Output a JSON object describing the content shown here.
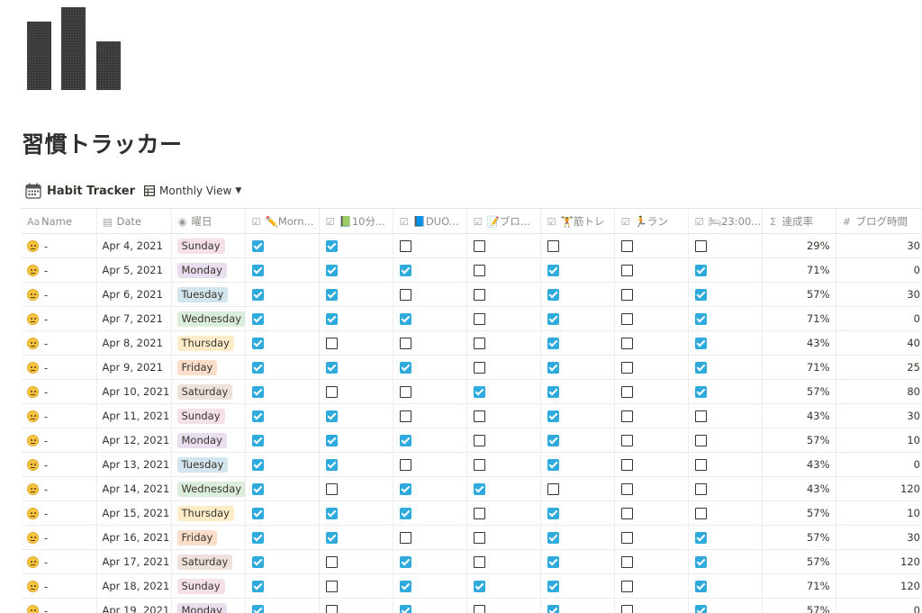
{
  "page": {
    "title": "習慣トラッカー"
  },
  "database": {
    "title": "Habit Tracker",
    "view_label": "Monthly View"
  },
  "columns": [
    {
      "key": "name",
      "label": "Name",
      "icon": "text-property-icon"
    },
    {
      "key": "date",
      "label": "Date",
      "icon": "calendar-property-icon"
    },
    {
      "key": "weekday",
      "label": "曜日",
      "icon": "select-property-icon"
    },
    {
      "key": "c1",
      "label": "✏️Morn...",
      "icon": "checkbox-property-icon"
    },
    {
      "key": "c2",
      "label": "📗10分...",
      "icon": "checkbox-property-icon"
    },
    {
      "key": "c3",
      "label": "📘DUO...",
      "icon": "checkbox-property-icon"
    },
    {
      "key": "c4",
      "label": "📝ブロ...",
      "icon": "checkbox-property-icon"
    },
    {
      "key": "c5",
      "label": "🏋筋トレ",
      "icon": "checkbox-property-icon"
    },
    {
      "key": "c6",
      "label": "🏃ラン",
      "icon": "checkbox-property-icon"
    },
    {
      "key": "c7",
      "label": "🛏23:00...",
      "icon": "checkbox-property-icon"
    },
    {
      "key": "rate",
      "label": "達成率",
      "icon": "formula-property-icon"
    },
    {
      "key": "blog",
      "label": "ブログ時間",
      "icon": "number-property-icon"
    }
  ],
  "weekday_colors": {
    "Sunday": "#f5e0e9",
    "Monday": "#e8deee",
    "Tuesday": "#d3e5ef",
    "Wednesday": "#dbeddb",
    "Thursday": "#fdecc8",
    "Friday": "#fadec9",
    "Saturday": "#eee0da"
  },
  "rows": [
    {
      "emoji": "weary-face",
      "name": "-",
      "date": "Apr 4, 2021",
      "weekday": "Sunday",
      "checks": [
        1,
        1,
        0,
        0,
        0,
        0,
        0
      ],
      "rate": "29%",
      "blog": "30"
    },
    {
      "emoji": "winking-face",
      "name": "-",
      "date": "Apr 5, 2021",
      "weekday": "Monday",
      "checks": [
        1,
        1,
        1,
        0,
        1,
        0,
        1
      ],
      "rate": "71%",
      "blog": "0"
    },
    {
      "emoji": "neutral-face",
      "name": "-",
      "date": "Apr 6, 2021",
      "weekday": "Tuesday",
      "checks": [
        1,
        1,
        0,
        0,
        1,
        0,
        1
      ],
      "rate": "57%",
      "blog": "30"
    },
    {
      "emoji": "neutral-face",
      "name": "-",
      "date": "Apr 7, 2021",
      "weekday": "Wednesday",
      "checks": [
        1,
        1,
        1,
        0,
        1,
        0,
        1
      ],
      "rate": "71%",
      "blog": "0"
    },
    {
      "emoji": "neutral-face",
      "name": "-",
      "date": "Apr 8, 2021",
      "weekday": "Thursday",
      "checks": [
        1,
        0,
        0,
        0,
        1,
        0,
        1
      ],
      "rate": "43%",
      "blog": "40"
    },
    {
      "emoji": "neutral-face",
      "name": "-",
      "date": "Apr 9, 2021",
      "weekday": "Friday",
      "checks": [
        1,
        1,
        1,
        0,
        1,
        0,
        1
      ],
      "rate": "71%",
      "blog": "25"
    },
    {
      "emoji": "neutral-face",
      "name": "-",
      "date": "Apr 10, 2021",
      "weekday": "Saturday",
      "checks": [
        1,
        0,
        0,
        1,
        1,
        0,
        1
      ],
      "rate": "57%",
      "blog": "80"
    },
    {
      "emoji": "weary-face",
      "name": "-",
      "date": "Apr 11, 2021",
      "weekday": "Sunday",
      "checks": [
        1,
        1,
        0,
        0,
        1,
        0,
        0
      ],
      "rate": "43%",
      "blog": "30"
    },
    {
      "emoji": "neutral-face",
      "name": "-",
      "date": "Apr 12, 2021",
      "weekday": "Monday",
      "checks": [
        1,
        1,
        1,
        0,
        1,
        0,
        0
      ],
      "rate": "57%",
      "blog": "10"
    },
    {
      "emoji": "weary-face",
      "name": "-",
      "date": "Apr 13, 2021",
      "weekday": "Tuesday",
      "checks": [
        1,
        1,
        0,
        0,
        1,
        0,
        0
      ],
      "rate": "43%",
      "blog": "0"
    },
    {
      "emoji": "winking-face",
      "name": "-",
      "date": "Apr 14, 2021",
      "weekday": "Wednesday",
      "checks": [
        1,
        0,
        1,
        1,
        0,
        0,
        0
      ],
      "rate": "43%",
      "blog": "120"
    },
    {
      "emoji": "neutral-face",
      "name": "-",
      "date": "Apr 15, 2021",
      "weekday": "Thursday",
      "checks": [
        1,
        1,
        1,
        0,
        1,
        0,
        0
      ],
      "rate": "57%",
      "blog": "10"
    },
    {
      "emoji": "neutral-face",
      "name": "-",
      "date": "Apr 16, 2021",
      "weekday": "Friday",
      "checks": [
        1,
        1,
        0,
        0,
        1,
        0,
        1
      ],
      "rate": "57%",
      "blog": "30"
    },
    {
      "emoji": "neutral-face",
      "name": "-",
      "date": "Apr 17, 2021",
      "weekday": "Saturday",
      "checks": [
        1,
        0,
        1,
        0,
        1,
        0,
        1
      ],
      "rate": "57%",
      "blog": "120"
    },
    {
      "emoji": "winking-face",
      "name": "-",
      "date": "Apr 18, 2021",
      "weekday": "Sunday",
      "checks": [
        1,
        0,
        1,
        1,
        1,
        0,
        1
      ],
      "rate": "71%",
      "blog": "120"
    },
    {
      "emoji": "neutral-face",
      "name": "-",
      "date": "Apr 19, 2021",
      "weekday": "Monday",
      "checks": [
        1,
        0,
        1,
        0,
        1,
        0,
        1
      ],
      "rate": "57%",
      "blog": "0"
    }
  ]
}
